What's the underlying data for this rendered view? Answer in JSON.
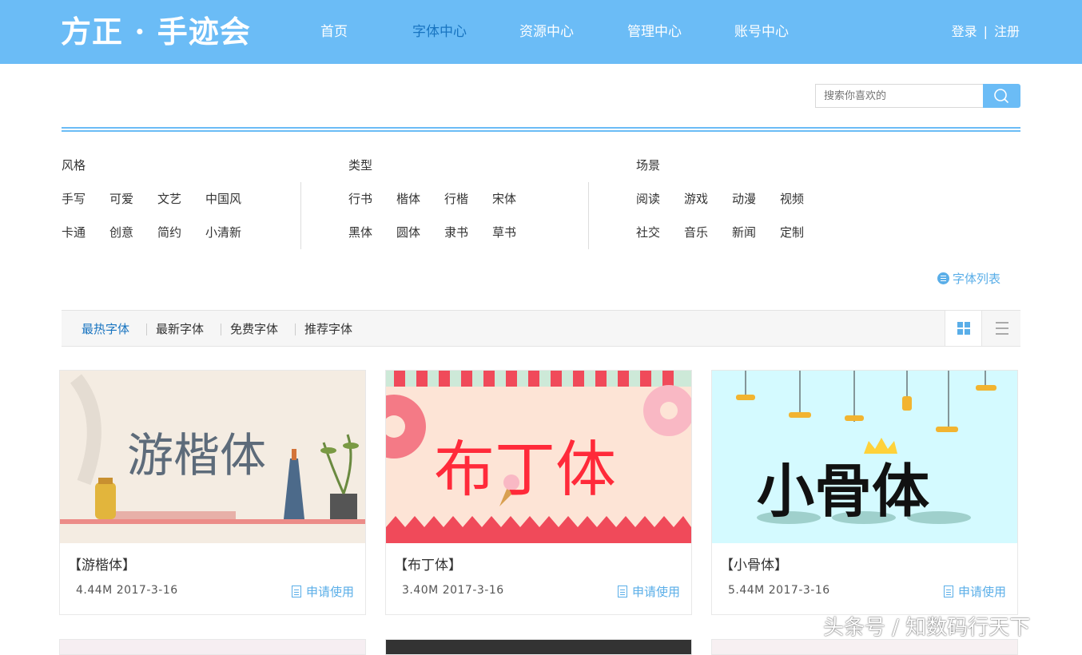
{
  "header": {
    "logo": "方正 · 手迹会",
    "nav": [
      {
        "label": "首页"
      },
      {
        "label": "字体中心"
      },
      {
        "label": "资源中心"
      },
      {
        "label": "管理中心"
      },
      {
        "label": "账号中心"
      }
    ],
    "active_nav": "字体中心",
    "login": "登录",
    "separator": "|",
    "register": "注册"
  },
  "search": {
    "placeholder": "搜索你喜欢的",
    "icon": "search-icon"
  },
  "filters": {
    "style": {
      "title": "风格",
      "row1": [
        "手写",
        "可爱",
        "文艺",
        "中国风"
      ],
      "row2": [
        "卡通",
        "创意",
        "简约",
        "小清新"
      ]
    },
    "type": {
      "title": "类型",
      "row1": [
        "行书",
        "楷体",
        "行楷",
        "宋体"
      ],
      "row2": [
        "黑体",
        "圆体",
        "隶书",
        "草书"
      ]
    },
    "scene": {
      "title": "场景",
      "row1": [
        "阅读",
        "游戏",
        "动漫",
        "视频"
      ],
      "row2": [
        "社交",
        "音乐",
        "新闻",
        "定制"
      ]
    }
  },
  "font_list_link": "字体列表",
  "tabs": [
    {
      "label": "最热字体"
    },
    {
      "label": "最新字体"
    },
    {
      "label": "免费字体"
    },
    {
      "label": "推荐字体"
    }
  ],
  "active_tab": "最热字体",
  "cards": [
    {
      "title": "【游楷体】",
      "meta": "4.44M 2017-3-16",
      "apply": "申请使用",
      "preview_text": "游楷体"
    },
    {
      "title": "【布丁体】",
      "meta": "3.40M 2017-3-16",
      "apply": "申请使用",
      "preview_text": "布丁体"
    },
    {
      "title": "【小骨体】",
      "meta": "5.44M 2017-3-16",
      "apply": "申请使用",
      "preview_text": "小骨体"
    }
  ],
  "watermark": "头条号 / 知数码行天下",
  "colors": {
    "brand": "#6bbcf6",
    "active": "#1874c0",
    "link": "#5aaee8"
  }
}
